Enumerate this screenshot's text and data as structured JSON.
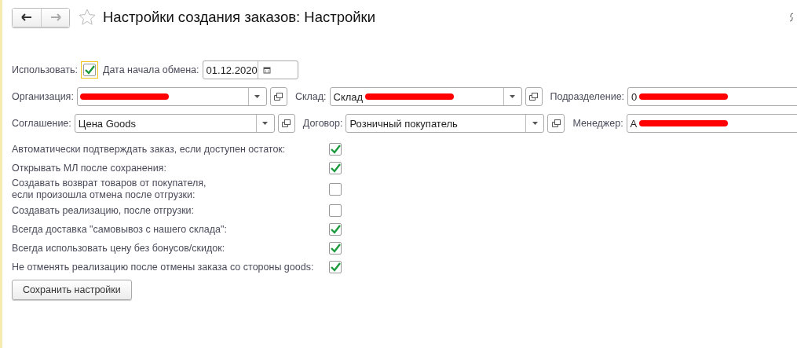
{
  "window": {
    "title": "Настройки создания заказов: Настройки",
    "favorite": false
  },
  "use_row": {
    "label": "Использовать:",
    "checked": true,
    "date_label": "Дата начала обмена:",
    "date_value": "01.12.2020"
  },
  "field_rows": [
    [
      {
        "label": "Организация:",
        "redacted": true,
        "kind": "select"
      },
      {
        "label": "Склад:",
        "value": "Склад",
        "redacted": true,
        "kind": "select"
      },
      {
        "label": "Подразделение:",
        "value": "0",
        "redacted": true,
        "kind": "plain"
      }
    ],
    [
      {
        "label": "Соглашение:",
        "value": "Цена Goods",
        "redacted": false,
        "kind": "select"
      },
      {
        "label": "Договор:",
        "value": "Розничный покупатель",
        "redacted": false,
        "kind": "select"
      },
      {
        "label": "Менеджер:",
        "value": "А",
        "redacted": true,
        "kind": "plain"
      }
    ]
  ],
  "options": [
    {
      "label": "Автоматически подтверждать заказ, если доступен остаток:",
      "checked": true
    },
    {
      "label": "Открывать МЛ после сохранения:",
      "checked": true
    },
    {
      "label": "Создавать возврат товаров от покупателя,\nесли произошла отмена после отгрузки:",
      "checked": false
    },
    {
      "label": "Создавать реализацию, после отгрузки:",
      "checked": false
    },
    {
      "label": "Всегда доставка \"самовывоз с нашего склада\":",
      "checked": true
    },
    {
      "label": "Всегда использовать цену без бонусов/скидок:",
      "checked": true
    },
    {
      "label": "Не отменять реализацию после отмены заказа со стороны goods:",
      "checked": true
    }
  ],
  "save_button": "Сохранить настройки"
}
